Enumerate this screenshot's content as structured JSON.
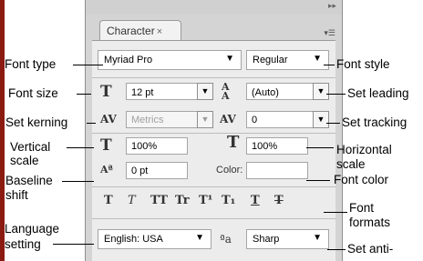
{
  "colors": {
    "stripe": "#8b1a10"
  },
  "panel": {
    "tab_label": "Character",
    "tab_close": "×",
    "collapse_glyph": "▸▸",
    "menu_glyph": "▾☰",
    "font_family": "Myriad Pro",
    "font_style": "Regular",
    "font_size": "12 pt",
    "leading": "(Auto)",
    "kerning": "Metrics",
    "tracking": "0",
    "vertical_scale": "100%",
    "horizontal_scale": "100%",
    "baseline_shift": "0 pt",
    "color_label": "Color:",
    "language": "English: USA",
    "antialias": "Sharp",
    "antialias_icon_text": "ªa",
    "format_buttons": [
      "T",
      "T",
      "TT",
      "Tr",
      "T¹",
      "T₁",
      "T",
      "T"
    ],
    "format_icon_names": [
      "faux-bold-icon",
      "faux-italic-icon",
      "all-caps-icon",
      "small-caps-icon",
      "superscript-icon",
      "subscript-icon",
      "underline-icon",
      "strikethrough-icon"
    ]
  },
  "callouts": {
    "font_type": "Font type",
    "font_style": "Font style",
    "font_size": "Font size",
    "set_leading": "Set leading",
    "set_kerning": "Set kerning",
    "set_tracking": "Set tracking",
    "vertical_1": "Vertical",
    "vertical_2": "scale",
    "horizontal_1": "Horizontal",
    "horizontal_2": "scale",
    "baseline_1": "Baseline",
    "baseline_2": "shift",
    "font_color": "Font color",
    "font_formats_1": "Font",
    "font_formats_2": "formats",
    "language_1": "Language",
    "language_2": "setting",
    "set_anti": "Set anti-"
  }
}
